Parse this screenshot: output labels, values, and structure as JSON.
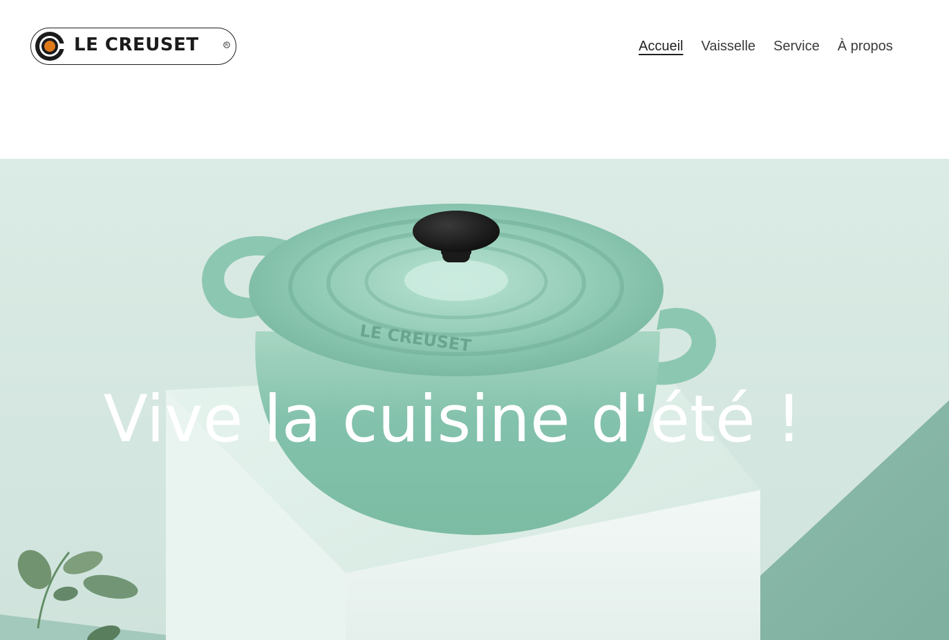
{
  "brand": {
    "name": "LE CREUSET",
    "registered_mark": "®",
    "accent_color": "#e07b1a",
    "lid_engraving": "LE CREUSET"
  },
  "nav": {
    "items": [
      {
        "label": "Accueil",
        "active": true
      },
      {
        "label": "Vaisselle",
        "active": false
      },
      {
        "label": "Service",
        "active": false
      },
      {
        "label": "À propos",
        "active": false
      }
    ]
  },
  "hero": {
    "headline": "Vive la cuisine d'été !",
    "image_subject": "sage green cast-iron cocotte on a white block with sage leaves",
    "pot_color": "#7fbfa9",
    "background_color": "#dcece6"
  }
}
